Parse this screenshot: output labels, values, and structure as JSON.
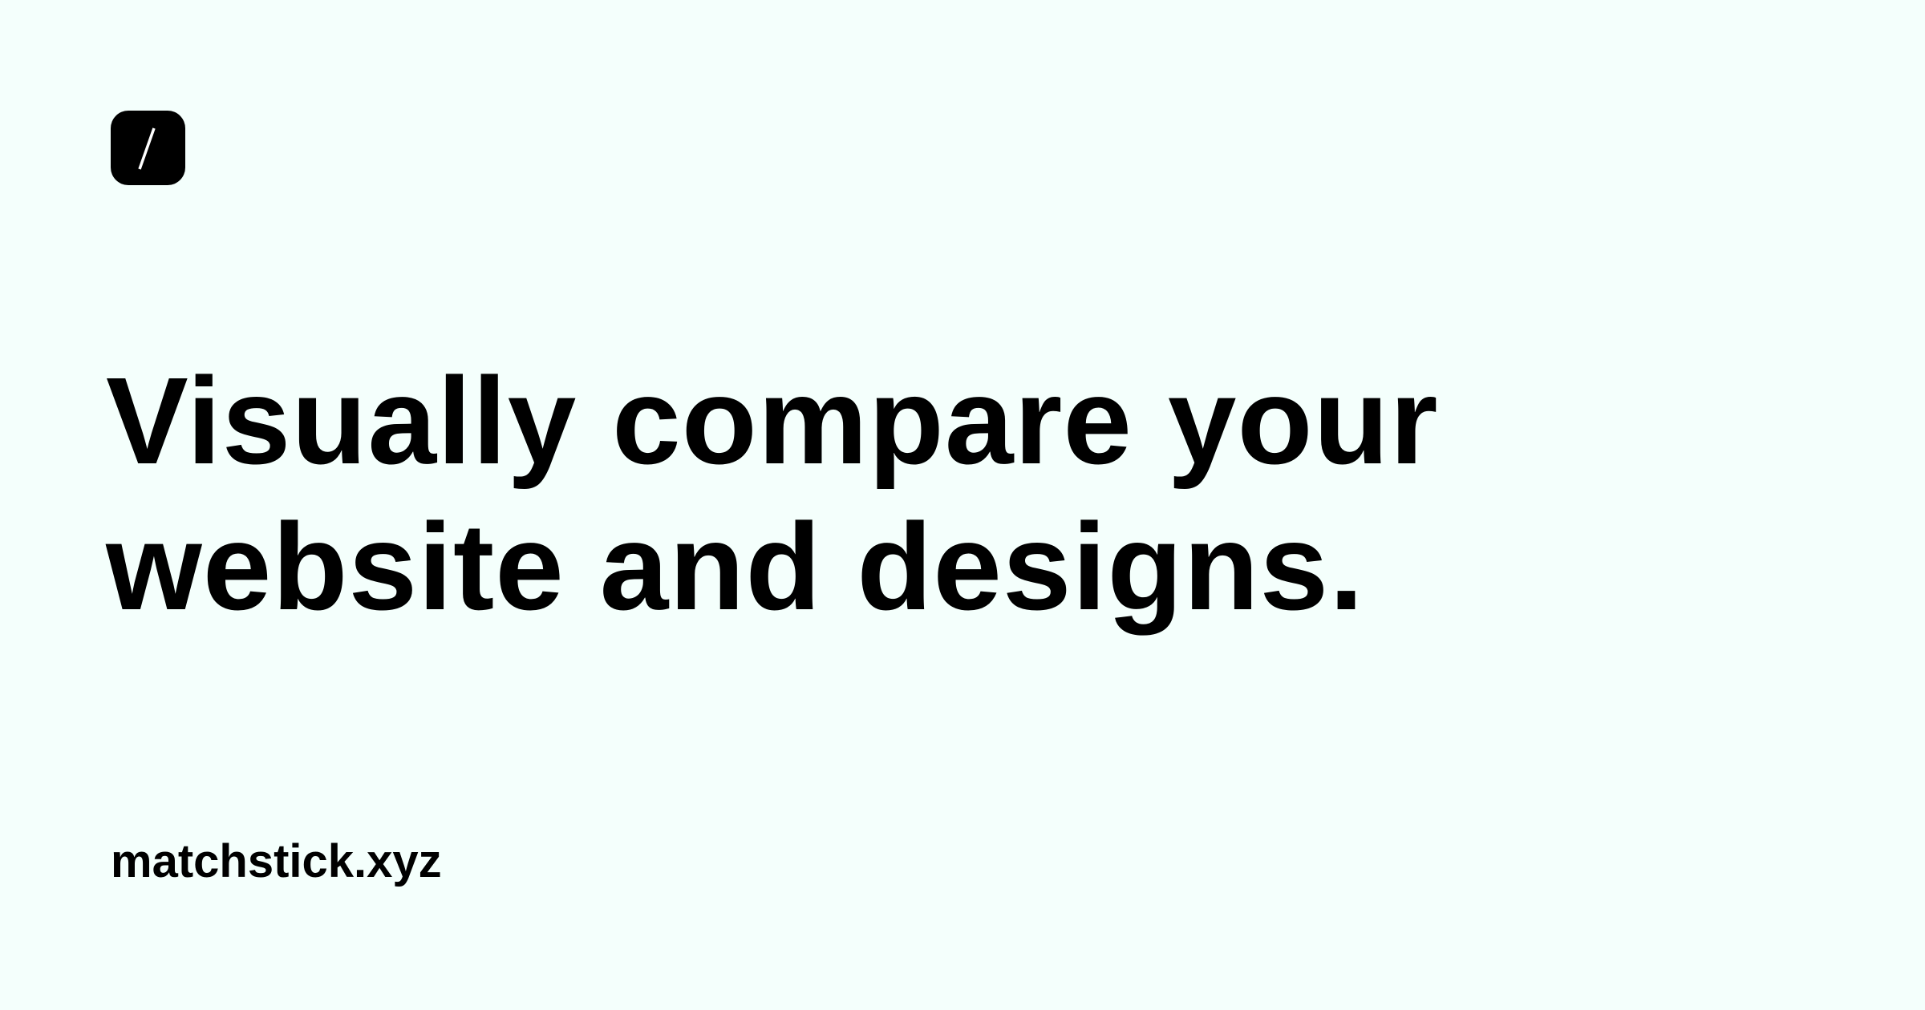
{
  "logo": {
    "icon": "slash-icon",
    "background_color": "#000000",
    "glyph_color": "#ffffff"
  },
  "headline": {
    "line1": "Visually compare your",
    "line2": "website and designs."
  },
  "footer": {
    "domain": "matchstick.xyz"
  },
  "colors": {
    "background": "#f4fffc",
    "text": "#000000"
  }
}
